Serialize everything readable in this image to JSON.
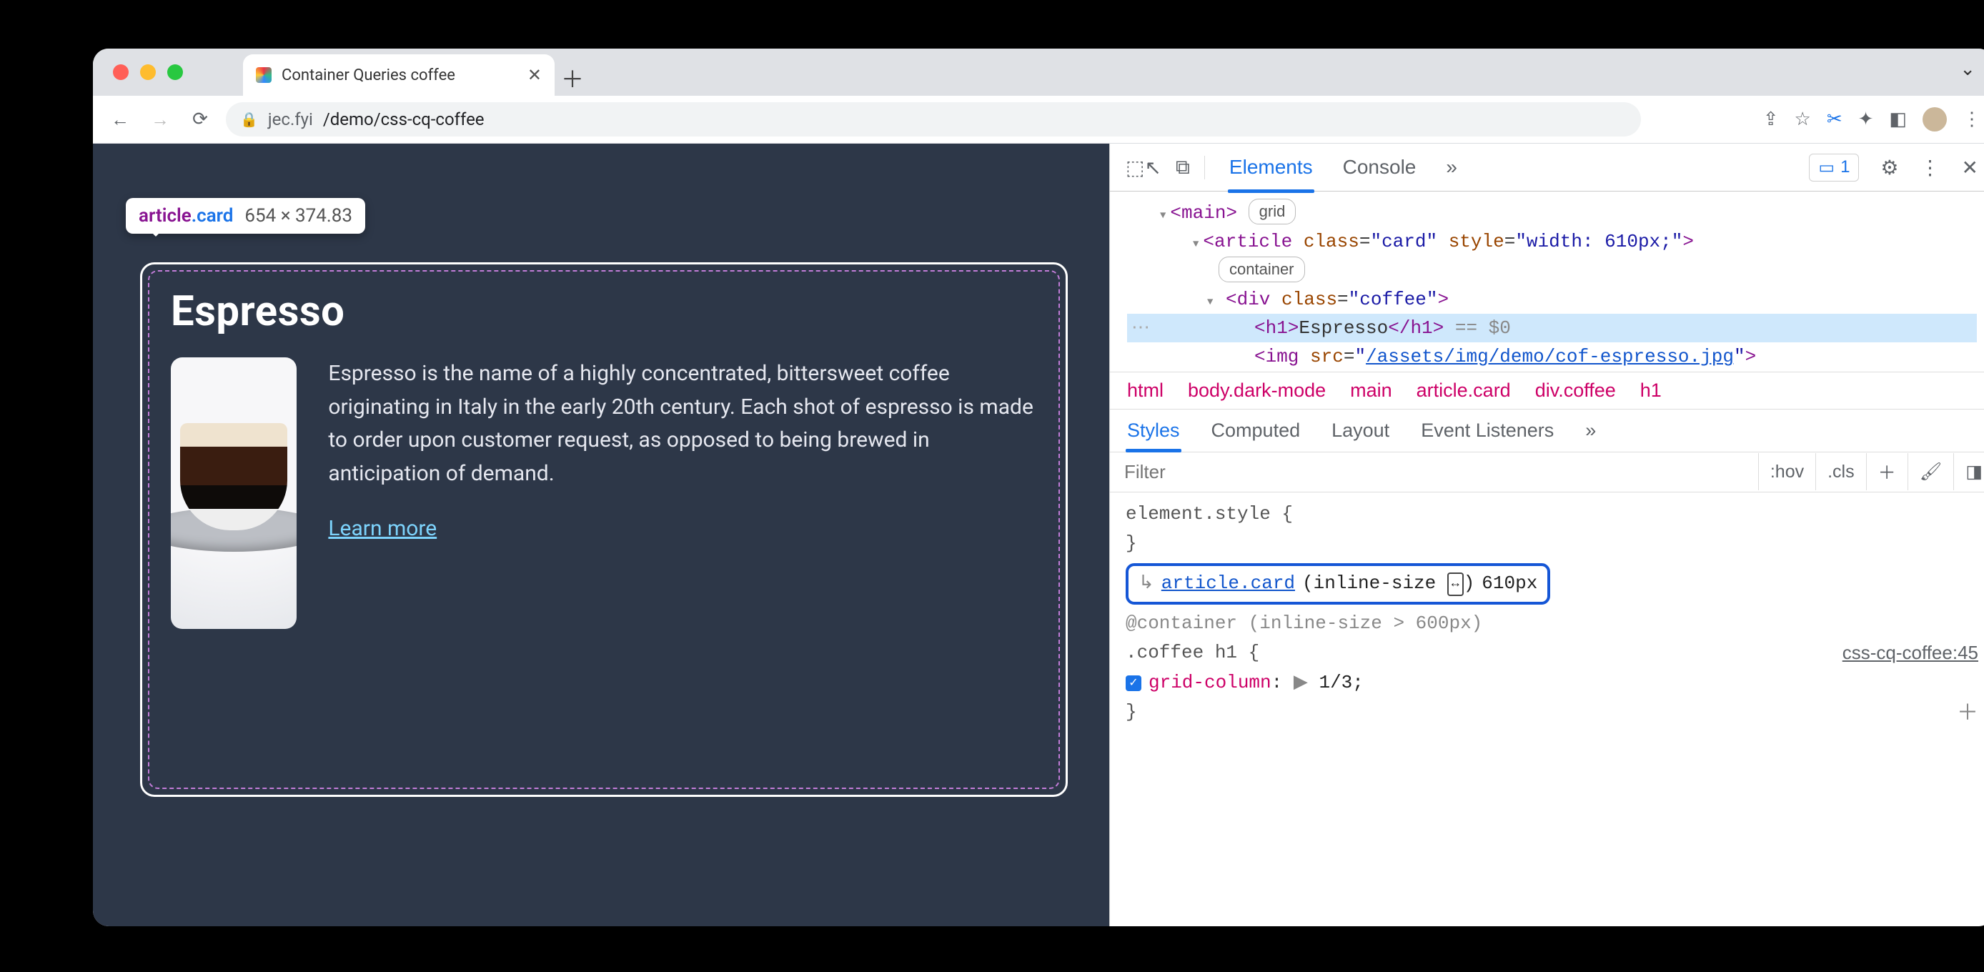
{
  "browserTab": {
    "title": "Container Queries coffee"
  },
  "url": {
    "host": "jec.fyi",
    "path": "/demo/css-cq-coffee"
  },
  "tooltip": {
    "selector_tag": "article",
    "selector_class": ".card",
    "dimensions": "654 × 374.83"
  },
  "card": {
    "title": "Espresso",
    "description": "Espresso is the name of a highly concentrated, bittersweet coffee originating in Italy in the early 20th century. Each shot of espresso is made to order upon customer request, as opposed to being brewed in anticipation of demand.",
    "learn": "Learn more"
  },
  "devtools": {
    "tabs": {
      "elements": "Elements",
      "console": "Console",
      "more": "»"
    },
    "issues_count": "1",
    "dom": {
      "main_open": "<main>",
      "main_badge": "grid",
      "article_open": "<article class=\"card\" style=\"width: 610px;\">",
      "article_badge": "container",
      "div_open": "<div class=\"coffee\">",
      "h1": "<h1>Espresso</h1>",
      "h1_suffix": " == $0",
      "img": "<img src=\"",
      "img_src": "/assets/img/demo/cof-espresso.jpg",
      "img_close": "\">"
    },
    "breadcrumb": [
      "html",
      "body.dark-mode",
      "main",
      "article.card",
      "div.coffee",
      "h1"
    ],
    "subtabs": {
      "styles": "Styles",
      "computed": "Computed",
      "layout": "Layout",
      "event": "Event Listeners",
      "more": "»"
    },
    "filter_placeholder": "Filter",
    "filter_tools": {
      "hov": ":hov",
      "cls": ".cls"
    },
    "styles": {
      "elstyle": "element.style {",
      "close": "}",
      "query_sel": "article.card",
      "query_dim": "(inline-size",
      "query_px": "610px",
      "at_container": "@container (inline-size > 600px)",
      "rule_sel": ".coffee h1 {",
      "src": "css-cq-coffee:45",
      "prop": "grid-column",
      "propv": "1/3;"
    }
  }
}
